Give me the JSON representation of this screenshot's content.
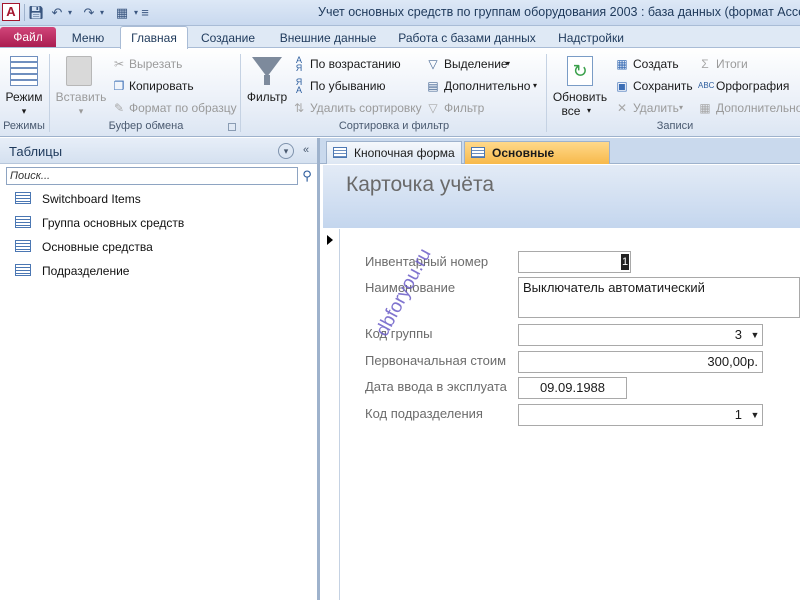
{
  "titlebar": {
    "app_icon_letter": "A",
    "window_title": "Учет основных средств по группам оборудования 2003 : база данных (формат Access 20"
  },
  "ribbon_tabs": [
    {
      "label": "Файл"
    },
    {
      "label": "Меню"
    },
    {
      "label": "Главная"
    },
    {
      "label": "Создание"
    },
    {
      "label": "Внешние данные"
    },
    {
      "label": "Работа с базами данных"
    },
    {
      "label": "Надстройки"
    }
  ],
  "ribbon": {
    "views": {
      "mode_label": "Режим",
      "group_label": "Режимы"
    },
    "clipboard": {
      "paste_label": "Вставить",
      "cut_label": "Вырезать",
      "copy_label": "Копировать",
      "format_painter_label": "Формат по образцу",
      "group_label": "Буфер обмена"
    },
    "sort_filter": {
      "filter_label": "Фильтр",
      "ascending_label": "По возрастанию",
      "descending_label": "По убыванию",
      "remove_sort_label": "Удалить сортировку",
      "selection_label": "Выделение",
      "advanced_label": "Дополнительно",
      "toggle_filter_label": "Фильтр",
      "group_label": "Сортировка и фильтр"
    },
    "records": {
      "refresh_label_1": "Обновить",
      "refresh_label_2": "все",
      "new_label": "Создать",
      "save_label": "Сохранить",
      "delete_label": "Удалить",
      "totals_label": "Итоги",
      "spelling_label": "Орфография",
      "more_label": "Дополнительно",
      "group_label": "Записи"
    }
  },
  "navpane": {
    "title": "Таблицы",
    "search_placeholder": "Поиск...",
    "items": [
      {
        "label": "Switchboard Items"
      },
      {
        "label": "Группа основных средств"
      },
      {
        "label": "Основные средства"
      },
      {
        "label": "Подразделение"
      }
    ]
  },
  "document": {
    "tabs": [
      {
        "label": "Кнопочная форма"
      },
      {
        "label": "Основные средства"
      }
    ],
    "form_title": "Карточка учёта",
    "fields": {
      "inventory_number": {
        "label": "Инвентарный номер",
        "value": "1"
      },
      "name": {
        "label": "Наименование",
        "value": "Выключатель автоматический"
      },
      "group_code": {
        "label": "Код группы",
        "value": "3"
      },
      "initial_cost": {
        "label": "Первоначальная стоим",
        "value": "300,00р."
      },
      "commission_date": {
        "label": "Дата ввода в эксплуата",
        "value": "09.09.1988"
      },
      "department_code": {
        "label": "Код подразделения",
        "value": "1"
      }
    }
  },
  "watermark": {
    "text": "dbforyou.ru"
  }
}
